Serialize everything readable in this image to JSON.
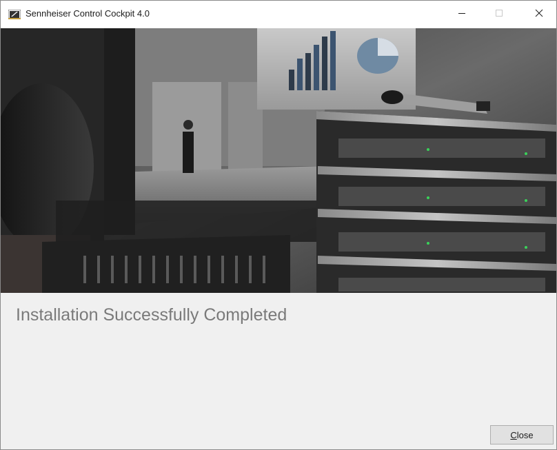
{
  "window": {
    "title": "Sennheiser Control Cockpit 4.0",
    "controls": {
      "minimize_icon": "minimize-icon",
      "maximize_icon": "maximize-icon",
      "close_icon": "close-icon"
    }
  },
  "banner": {
    "description_icon": "banner-image"
  },
  "content": {
    "heading": "Installation Successfully Completed",
    "close_button": {
      "accelerator": "C",
      "rest": "lose"
    }
  },
  "colors": {
    "heading_text": "#7a7a7a",
    "content_background": "#f0f0f0",
    "button_background": "#e1e1e1",
    "button_border": "#adadad"
  }
}
